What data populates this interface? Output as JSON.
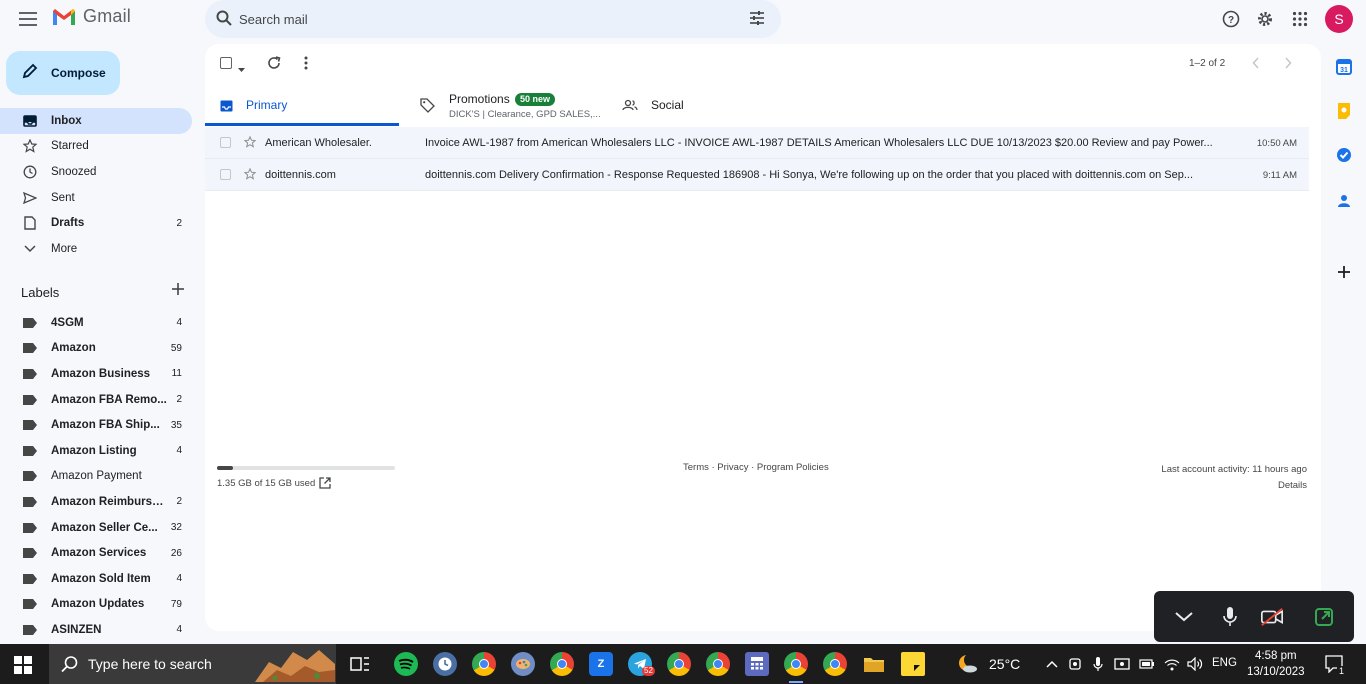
{
  "header": {
    "app_name": "Gmail",
    "search_placeholder": "Search mail",
    "avatar_initial": "S"
  },
  "sidebar": {
    "compose_label": "Compose",
    "nav": [
      {
        "label": "Inbox",
        "count": "",
        "icon": "inbox-icon",
        "active": true
      },
      {
        "label": "Starred",
        "count": "",
        "icon": "star-icon"
      },
      {
        "label": "Snoozed",
        "count": "",
        "icon": "clock-icon"
      },
      {
        "label": "Sent",
        "count": "",
        "icon": "send-icon"
      },
      {
        "label": "Drafts",
        "count": "2",
        "icon": "draft-icon"
      },
      {
        "label": "More",
        "count": "",
        "icon": "chevron-down-icon"
      }
    ],
    "labels_title": "Labels",
    "labels": [
      {
        "name": "4SGM",
        "count": "4"
      },
      {
        "name": "Amazon",
        "count": "59"
      },
      {
        "name": "Amazon Business",
        "count": "11"
      },
      {
        "name": "Amazon FBA Remo...",
        "count": "2"
      },
      {
        "name": "Amazon FBA Ship...",
        "count": "35"
      },
      {
        "name": "Amazon Listing",
        "count": "4"
      },
      {
        "name": "Amazon Payment",
        "count": ""
      },
      {
        "name": "Amazon Reimburse...",
        "count": "2"
      },
      {
        "name": "Amazon Seller Ce...",
        "count": "32"
      },
      {
        "name": "Amazon Services",
        "count": "26"
      },
      {
        "name": "Amazon Sold Item",
        "count": "4"
      },
      {
        "name": "Amazon Updates",
        "count": "79"
      },
      {
        "name": "ASINZEN",
        "count": "4"
      }
    ]
  },
  "toolbar": {
    "pager": "1–2 of 2"
  },
  "tabs": {
    "primary": "Primary",
    "promotions": "Promotions",
    "promotions_badge": "50 new",
    "promotions_sub": "DICK'S | Clearance, GPD SALES,...",
    "social": "Social"
  },
  "emails": [
    {
      "sender": "American Wholesaler.",
      "subject": "Invoice AWL-1987 from American Wholesalers LLC - INVOICE AWL-1987 DETAILS American Wholesalers LLC DUE 10/13/2023 $20.00 Review and pay Power...",
      "time": "10:50 AM"
    },
    {
      "sender": "doittennis.com",
      "subject": "doittennis.com Delivery Confirmation - Response Requested 186908 - Hi Sonya, We're following up on the order that you placed with doittennis.com on Sep...",
      "time": "9:11 AM"
    }
  ],
  "footer": {
    "storage_text": "1.35 GB of 15 GB used",
    "storage_fraction": 0.09,
    "links": "Terms · Privacy · Program Policies",
    "last_activity": "Last account activity: 11 hours ago",
    "details": "Details"
  },
  "taskbar": {
    "search_text": "Type here to search",
    "telegram_badge": "52",
    "weather": "25°C",
    "language": "ENG",
    "time": "4:58 pm",
    "date": "13/10/2023",
    "notification_count": "1"
  },
  "colors": {
    "accent": "#0b57d0",
    "compose_bg": "#c2e7ff",
    "active_nav": "#d3e3fd",
    "badge_green": "#188038",
    "avatar": "#d81b60"
  }
}
